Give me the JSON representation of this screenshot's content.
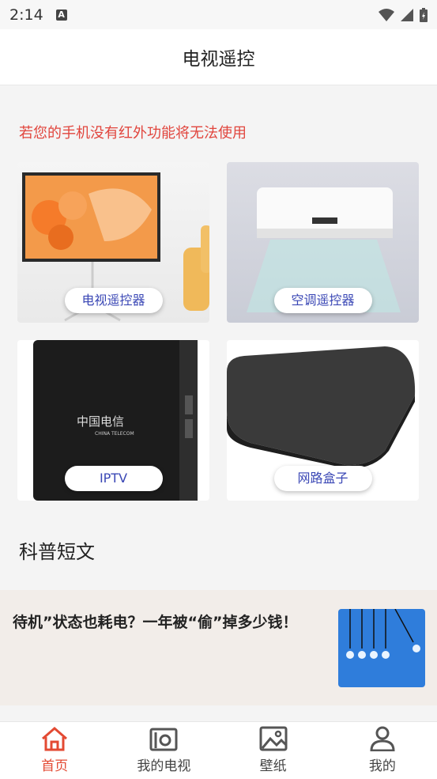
{
  "status_bar": {
    "time": "2:14"
  },
  "header": {
    "title": "电视遥控"
  },
  "warning": "若您的手机没有红外功能将无法使用",
  "cards": [
    {
      "label": "电视遥控器"
    },
    {
      "label": "空调遥控器"
    },
    {
      "label": "IPTV"
    },
    {
      "label": "网路盒子"
    }
  ],
  "section_title": "科普短文",
  "article": {
    "title": "待机”状态也耗电？一年被“偷”掉多少钱！"
  },
  "tabs": [
    {
      "label": "首页"
    },
    {
      "label": "我的电视"
    },
    {
      "label": "壁纸"
    },
    {
      "label": "我的"
    }
  ],
  "colors": {
    "accent": "#e34a33",
    "label_text": "#3a47b5"
  }
}
